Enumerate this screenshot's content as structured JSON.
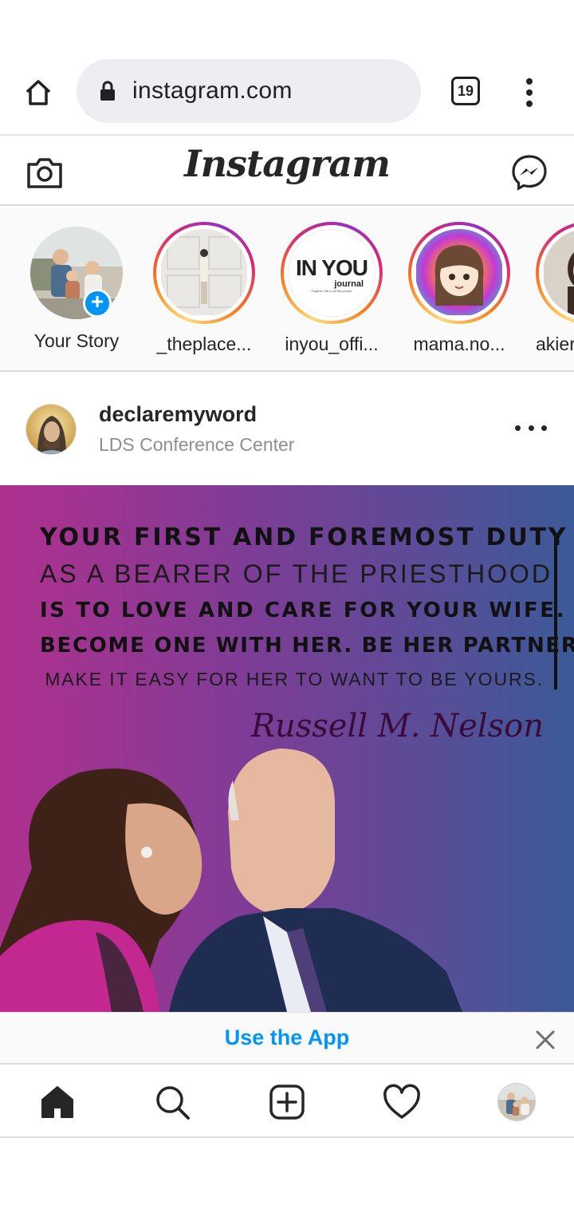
{
  "browser": {
    "url": "instagram.com",
    "tab_count": "19"
  },
  "header": {
    "logo": "Instagram"
  },
  "stories": [
    {
      "label": "Your Story"
    },
    {
      "label": "_theplace..."
    },
    {
      "label": "inyou_offi..."
    },
    {
      "label": "mama.no..."
    },
    {
      "label": "akier"
    }
  ],
  "story_logo": {
    "main": "IN YOU",
    "sub": "journal",
    "tagline": "Organic Life to all the people"
  },
  "post": {
    "username": "declaremyword",
    "location": "LDS Conference Center",
    "quote": {
      "line1": "Your first and foremost duty",
      "line2": "as a bearer of the priesthood",
      "line3": "is to love and care for your wife.",
      "line4": "Become one with her. Be her partner.",
      "line5": "Make it easy for her to want to be yours.",
      "signature": "Russell M. Nelson"
    }
  },
  "banner": {
    "text": "Use the App"
  },
  "colors": {
    "accent": "#0095f6",
    "text": "#262626",
    "muted": "#8e8e8e",
    "border": "#dbdbdb"
  }
}
